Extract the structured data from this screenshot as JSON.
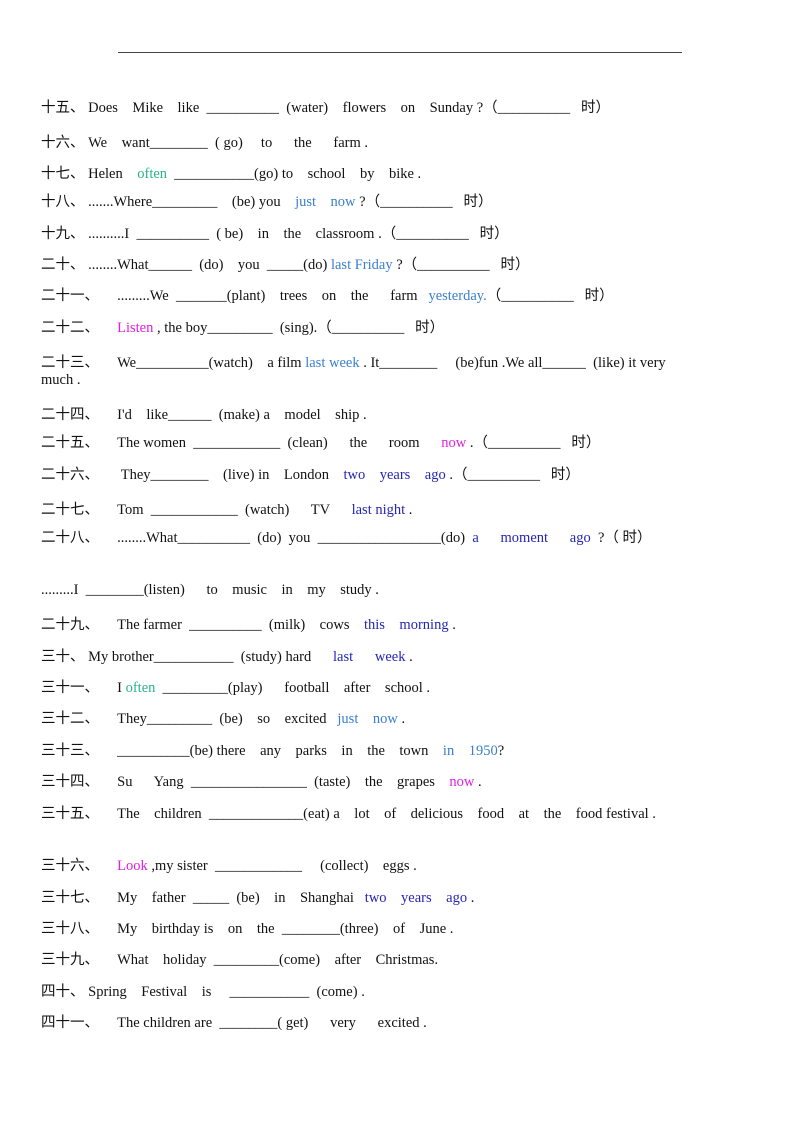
{
  "colors": {
    "teal": "#2bb38a",
    "light_blue": "#3a7fd0",
    "magenta": "#e020e0",
    "dark_blue": "#2525b5"
  },
  "items": [
    {
      "segs": [
        {
          "t": "十五、 Does    Mike    like  __________  (water)    flowers    on    Sunday ?（__________   时）"
        }
      ]
    },
    {
      "segs": [
        {
          "t": "十六、 We    want________  ( go)     to      the      farm ."
        }
      ]
    },
    {
      "segs": [
        {
          "t": "十七、 Helen    "
        },
        {
          "t": "often",
          "c": "teal"
        },
        {
          "t": "  ___________(go) to    school    by    bike ."
        }
      ]
    },
    {
      "segs": [
        {
          "t": "十八、 .......Where_________    (be) you    "
        },
        {
          "t": "just    now",
          "c": "lblue"
        },
        {
          "t": " ?（__________   时）"
        }
      ]
    },
    {
      "segs": [
        {
          "t": "十九、 ..........I  __________  ( be)    in    the    classroom .（__________   时）"
        }
      ]
    },
    {
      "segs": [
        {
          "t": "二十、 ........What______  (do)    you  _____(do) "
        },
        {
          "t": "last Friday",
          "c": "lblue"
        },
        {
          "t": " ?（__________   时）"
        }
      ]
    },
    {
      "segs": [
        {
          "t": "二十一、     .........We  _______(plant)    trees    on    the      farm   "
        },
        {
          "t": "yesterday.",
          "c": "lblue"
        },
        {
          "t": "（__________   时）"
        }
      ]
    },
    {
      "segs": [
        {
          "t": "二十二、     "
        },
        {
          "t": "Listen",
          "c": "magenta"
        },
        {
          "t": " , the boy_________  (sing).（__________   时）"
        }
      ]
    },
    {
      "segs": [
        {
          "t": "二十三、     We__________(watch)    a film "
        },
        {
          "t": "last week",
          "c": "lblue"
        },
        {
          "t": " . It________     (be)fun .We all______  (like) it very much ."
        }
      ],
      "wrap": true
    },
    {
      "segs": [
        {
          "t": "二十四、     I'd    like______  (make) a    model    ship ."
        }
      ]
    },
    {
      "segs": [
        {
          "t": "二十五、     The women  ____________  (clean)      the      room      "
        },
        {
          "t": "now",
          "c": "magenta"
        },
        {
          "t": " .（__________   时）"
        }
      ]
    },
    {
      "segs": [
        {
          "t": "二十六、      They________    (live) in    London    "
        },
        {
          "t": "two    years    ago",
          "c": "dblue"
        },
        {
          "t": " .（__________   时）"
        }
      ]
    },
    {
      "segs": [
        {
          "t": "二十七、     Tom  ____________  (watch)      TV      "
        },
        {
          "t": "last night",
          "c": "dblue"
        },
        {
          "t": " ."
        }
      ]
    },
    {
      "segs": [
        {
          "t": "二十八、     ........What__________  (do)  you  _________________(do)  "
        },
        {
          "t": "a      moment      ago",
          "c": "dblue"
        },
        {
          "t": "  ?（ 时）"
        }
      ],
      "wrap": true
    },
    {
      "segs": [
        {
          "t": ".........I  ________(listen)      to    music    in    my    study ."
        }
      ]
    },
    {
      "segs": [
        {
          "t": "二十九、     The farmer  __________  (milk)    cows    "
        },
        {
          "t": "this    morning",
          "c": "dblue"
        },
        {
          "t": " ."
        }
      ]
    },
    {
      "segs": [
        {
          "t": "三十、 My brother___________  (study) hard      "
        },
        {
          "t": "last      week",
          "c": "dblue"
        },
        {
          "t": " ."
        }
      ]
    },
    {
      "segs": [
        {
          "t": "三十一、     I "
        },
        {
          "t": "often",
          "c": "teal"
        },
        {
          "t": "  _________(play)      football    after    school ."
        }
      ]
    },
    {
      "segs": [
        {
          "t": "三十二、     They_________  (be)    so    excited   "
        },
        {
          "t": "just    now",
          "c": "lblue"
        },
        {
          "t": " ."
        }
      ]
    },
    {
      "segs": [
        {
          "t": "三十三、     __________(be) there    any    parks    in    the    town    "
        },
        {
          "t": "in    1950",
          "c": "lblue"
        },
        {
          "t": "?"
        }
      ]
    },
    {
      "segs": [
        {
          "t": "三十四、     Su      Yang  ________________  (taste)    the    grapes    "
        },
        {
          "t": "now",
          "c": "magenta"
        },
        {
          "t": " ."
        }
      ]
    },
    {
      "segs": [
        {
          "t": "三十五、     The    children  _____________(eat) a    lot    of    delicious    food    at    the    food festival ."
        }
      ],
      "wrap": true
    },
    {
      "segs": [
        {
          "t": "三十六、     "
        },
        {
          "t": "Look",
          "c": "magenta"
        },
        {
          "t": " ,my sister  ____________     (collect)    eggs ."
        }
      ]
    },
    {
      "segs": [
        {
          "t": "三十七、     My    father  _____  (be)    in    Shanghai   "
        },
        {
          "t": "two    years    ago",
          "c": "dblue"
        },
        {
          "t": " ."
        }
      ]
    },
    {
      "segs": [
        {
          "t": "三十八、     My    birthday is    on    the  ________(three)    of    June ."
        }
      ]
    },
    {
      "segs": [
        {
          "t": "三十九、     What    holiday  _________(come)    after    Christmas."
        }
      ]
    },
    {
      "segs": [
        {
          "t": "四十、 Spring    Festival    is     ___________  (come) ."
        }
      ]
    },
    {
      "segs": [
        {
          "t": "四十一、     The children are  ________( get)      very      excited ."
        }
      ]
    }
  ]
}
